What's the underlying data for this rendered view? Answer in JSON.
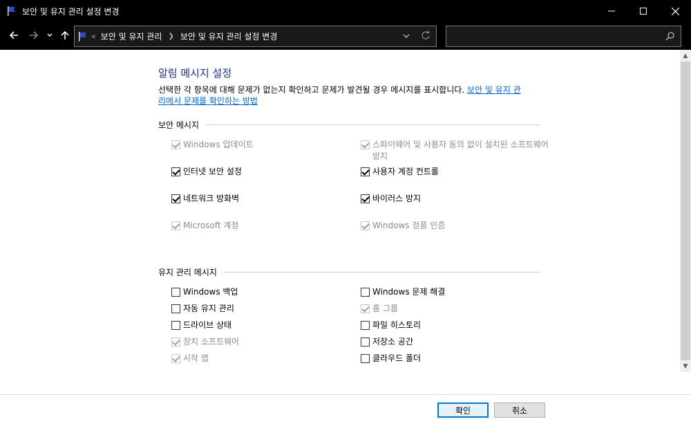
{
  "window": {
    "title": "보안 및 유지 관리 설정 변경"
  },
  "nav": {
    "breadcrumb_overflow": "«",
    "breadcrumb": [
      "보안 및 유지 관리",
      "보안 및 유지 관리 설정 변경"
    ],
    "search_placeholder": ""
  },
  "main": {
    "heading": "알림 메시지 설정",
    "description": "선택한 각 항목에 대해 문제가 없는지 확인하고 문제가 발견될 경우 메시지를 표시합니다.",
    "help_link_line1": "보안 및 유지 관",
    "help_link_line2": "리에서 문제를 확인하는 방법",
    "security_group": {
      "label": "보안 메시지",
      "items": [
        {
          "label": "Windows 업데이트",
          "checked": true,
          "disabled": true
        },
        {
          "label": "스파이웨어 및 사용자 동의 없이 설치된 소프트웨어 방지",
          "checked": true,
          "disabled": true
        },
        {
          "label": "인터넷 보안 설정",
          "checked": true,
          "disabled": false
        },
        {
          "label": "사용자 계정 컨트롤",
          "checked": true,
          "disabled": false
        },
        {
          "label": "네트워크 방화벽",
          "checked": true,
          "disabled": false
        },
        {
          "label": "바이러스 방지",
          "checked": true,
          "disabled": false
        },
        {
          "label": "Microsoft 계정",
          "checked": true,
          "disabled": true
        },
        {
          "label": "Windows 정품 인증",
          "checked": true,
          "disabled": true
        }
      ]
    },
    "maintenance_group": {
      "label": "유지 관리 메시지",
      "items": [
        {
          "label": "Windows 백업",
          "checked": false,
          "disabled": false
        },
        {
          "label": "Windows 문제 해결",
          "checked": false,
          "disabled": false
        },
        {
          "label": "자동 유지 관리",
          "checked": false,
          "disabled": false
        },
        {
          "label": "홈 그룹",
          "checked": true,
          "disabled": true
        },
        {
          "label": "드라이브 상태",
          "checked": false,
          "disabled": false
        },
        {
          "label": "파일 히스토리",
          "checked": false,
          "disabled": false
        },
        {
          "label": "장치 소프트웨어",
          "checked": true,
          "disabled": true
        },
        {
          "label": "저장소 공간",
          "checked": false,
          "disabled": false
        },
        {
          "label": "시작 앱",
          "checked": true,
          "disabled": true
        },
        {
          "label": "클라우드 폴더",
          "checked": false,
          "disabled": false
        }
      ]
    }
  },
  "buttons": {
    "ok": "확인",
    "cancel": "취소"
  },
  "colors": {
    "heading": "#1e3287",
    "link": "#0066cc",
    "primary_border": "#0078d7"
  }
}
